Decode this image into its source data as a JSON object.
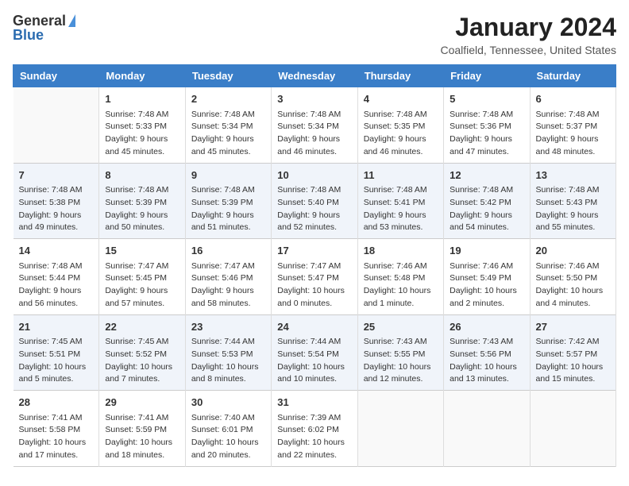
{
  "header": {
    "logo_general": "General",
    "logo_blue": "Blue",
    "title": "January 2024",
    "subtitle": "Coalfield, Tennessee, United States"
  },
  "weekdays": [
    "Sunday",
    "Monday",
    "Tuesday",
    "Wednesday",
    "Thursday",
    "Friday",
    "Saturday"
  ],
  "weeks": [
    [
      {
        "day": "",
        "info": ""
      },
      {
        "day": "1",
        "info": "Sunrise: 7:48 AM\nSunset: 5:33 PM\nDaylight: 9 hours\nand 45 minutes."
      },
      {
        "day": "2",
        "info": "Sunrise: 7:48 AM\nSunset: 5:34 PM\nDaylight: 9 hours\nand 45 minutes."
      },
      {
        "day": "3",
        "info": "Sunrise: 7:48 AM\nSunset: 5:34 PM\nDaylight: 9 hours\nand 46 minutes."
      },
      {
        "day": "4",
        "info": "Sunrise: 7:48 AM\nSunset: 5:35 PM\nDaylight: 9 hours\nand 46 minutes."
      },
      {
        "day": "5",
        "info": "Sunrise: 7:48 AM\nSunset: 5:36 PM\nDaylight: 9 hours\nand 47 minutes."
      },
      {
        "day": "6",
        "info": "Sunrise: 7:48 AM\nSunset: 5:37 PM\nDaylight: 9 hours\nand 48 minutes."
      }
    ],
    [
      {
        "day": "7",
        "info": "Sunrise: 7:48 AM\nSunset: 5:38 PM\nDaylight: 9 hours\nand 49 minutes."
      },
      {
        "day": "8",
        "info": "Sunrise: 7:48 AM\nSunset: 5:39 PM\nDaylight: 9 hours\nand 50 minutes."
      },
      {
        "day": "9",
        "info": "Sunrise: 7:48 AM\nSunset: 5:39 PM\nDaylight: 9 hours\nand 51 minutes."
      },
      {
        "day": "10",
        "info": "Sunrise: 7:48 AM\nSunset: 5:40 PM\nDaylight: 9 hours\nand 52 minutes."
      },
      {
        "day": "11",
        "info": "Sunrise: 7:48 AM\nSunset: 5:41 PM\nDaylight: 9 hours\nand 53 minutes."
      },
      {
        "day": "12",
        "info": "Sunrise: 7:48 AM\nSunset: 5:42 PM\nDaylight: 9 hours\nand 54 minutes."
      },
      {
        "day": "13",
        "info": "Sunrise: 7:48 AM\nSunset: 5:43 PM\nDaylight: 9 hours\nand 55 minutes."
      }
    ],
    [
      {
        "day": "14",
        "info": "Sunrise: 7:48 AM\nSunset: 5:44 PM\nDaylight: 9 hours\nand 56 minutes."
      },
      {
        "day": "15",
        "info": "Sunrise: 7:47 AM\nSunset: 5:45 PM\nDaylight: 9 hours\nand 57 minutes."
      },
      {
        "day": "16",
        "info": "Sunrise: 7:47 AM\nSunset: 5:46 PM\nDaylight: 9 hours\nand 58 minutes."
      },
      {
        "day": "17",
        "info": "Sunrise: 7:47 AM\nSunset: 5:47 PM\nDaylight: 10 hours\nand 0 minutes."
      },
      {
        "day": "18",
        "info": "Sunrise: 7:46 AM\nSunset: 5:48 PM\nDaylight: 10 hours\nand 1 minute."
      },
      {
        "day": "19",
        "info": "Sunrise: 7:46 AM\nSunset: 5:49 PM\nDaylight: 10 hours\nand 2 minutes."
      },
      {
        "day": "20",
        "info": "Sunrise: 7:46 AM\nSunset: 5:50 PM\nDaylight: 10 hours\nand 4 minutes."
      }
    ],
    [
      {
        "day": "21",
        "info": "Sunrise: 7:45 AM\nSunset: 5:51 PM\nDaylight: 10 hours\nand 5 minutes."
      },
      {
        "day": "22",
        "info": "Sunrise: 7:45 AM\nSunset: 5:52 PM\nDaylight: 10 hours\nand 7 minutes."
      },
      {
        "day": "23",
        "info": "Sunrise: 7:44 AM\nSunset: 5:53 PM\nDaylight: 10 hours\nand 8 minutes."
      },
      {
        "day": "24",
        "info": "Sunrise: 7:44 AM\nSunset: 5:54 PM\nDaylight: 10 hours\nand 10 minutes."
      },
      {
        "day": "25",
        "info": "Sunrise: 7:43 AM\nSunset: 5:55 PM\nDaylight: 10 hours\nand 12 minutes."
      },
      {
        "day": "26",
        "info": "Sunrise: 7:43 AM\nSunset: 5:56 PM\nDaylight: 10 hours\nand 13 minutes."
      },
      {
        "day": "27",
        "info": "Sunrise: 7:42 AM\nSunset: 5:57 PM\nDaylight: 10 hours\nand 15 minutes."
      }
    ],
    [
      {
        "day": "28",
        "info": "Sunrise: 7:41 AM\nSunset: 5:58 PM\nDaylight: 10 hours\nand 17 minutes."
      },
      {
        "day": "29",
        "info": "Sunrise: 7:41 AM\nSunset: 5:59 PM\nDaylight: 10 hours\nand 18 minutes."
      },
      {
        "day": "30",
        "info": "Sunrise: 7:40 AM\nSunset: 6:01 PM\nDaylight: 10 hours\nand 20 minutes."
      },
      {
        "day": "31",
        "info": "Sunrise: 7:39 AM\nSunset: 6:02 PM\nDaylight: 10 hours\nand 22 minutes."
      },
      {
        "day": "",
        "info": ""
      },
      {
        "day": "",
        "info": ""
      },
      {
        "day": "",
        "info": ""
      }
    ]
  ]
}
